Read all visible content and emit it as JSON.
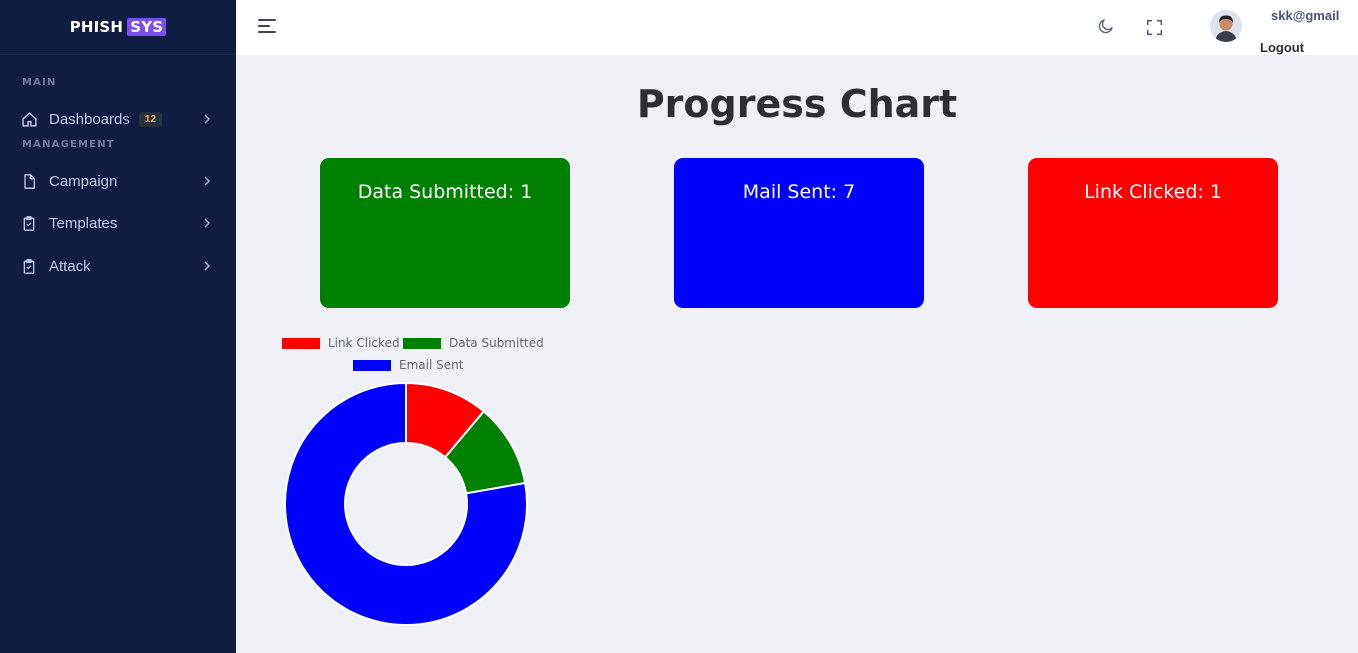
{
  "brand": {
    "part1": "PHISH",
    "part2": "SYS",
    "accent": "#7b4ef0"
  },
  "sidebar": {
    "sections": [
      {
        "label": "MAIN"
      },
      {
        "label": "MANAGEMENT"
      }
    ],
    "items": [
      {
        "label": "Dashboards",
        "icon": "home-icon",
        "badge": "12"
      },
      {
        "label": "Campaign",
        "icon": "file-icon"
      },
      {
        "label": "Templates",
        "icon": "clipboard-check-icon"
      },
      {
        "label": "Attack",
        "icon": "clipboard-check-icon"
      }
    ]
  },
  "header": {
    "icons": [
      "menu-icon",
      "moon-icon",
      "fullscreen-icon"
    ],
    "user": {
      "email": "skk@gmail",
      "logout_label": "Logout"
    }
  },
  "main": {
    "title": "Progress Chart",
    "cards": [
      {
        "label": "Data Submitted:",
        "value": "1",
        "color": "#008000"
      },
      {
        "label": "Mail Sent:",
        "value": "7",
        "color": "#0000ff"
      },
      {
        "label": "Link Clicked:",
        "value": "1",
        "color": "#ff0000"
      }
    ]
  },
  "chart_data": {
    "type": "pie",
    "variant": "doughnut",
    "title": "",
    "legend_position": "top",
    "labels": [
      "Link Clicked",
      "Data Submitted",
      "Email Sent"
    ],
    "values": [
      1,
      1,
      7
    ],
    "colors": [
      "#ff0000",
      "#008000",
      "#0000ff"
    ]
  }
}
